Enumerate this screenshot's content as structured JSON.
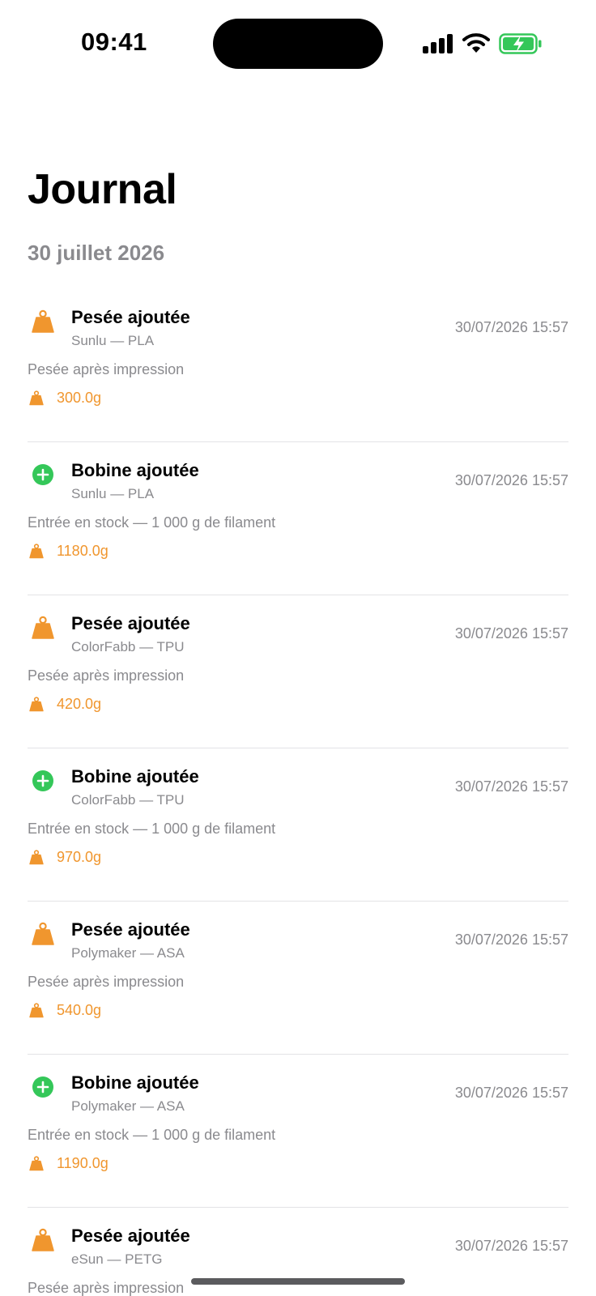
{
  "status_bar": {
    "time": "09:41",
    "signal_icon": "cellular-signal-icon",
    "wifi_icon": "wifi-icon",
    "battery_icon": "battery-charging-icon"
  },
  "header": {
    "title": "Journal"
  },
  "section": {
    "date": "30 juillet 2026"
  },
  "colors": {
    "accent_orange": "#f0962e",
    "add_green": "#34c759",
    "secondary_text": "#8a8a8e"
  },
  "entries": [
    {
      "type": "weigh",
      "icon": "weight-icon",
      "title": "Pesée ajoutée",
      "subtitle": "Sunlu — PLA",
      "timestamp": "30/07/2026 15:57",
      "note": "Pesée après impression",
      "weight": "300.0g"
    },
    {
      "type": "add",
      "icon": "plus-circle-icon",
      "title": "Bobine ajoutée",
      "subtitle": "Sunlu — PLA",
      "timestamp": "30/07/2026 15:57",
      "note": "Entrée en stock — 1 000 g de filament",
      "weight": "1180.0g"
    },
    {
      "type": "weigh",
      "icon": "weight-icon",
      "title": "Pesée ajoutée",
      "subtitle": "ColorFabb — TPU",
      "timestamp": "30/07/2026 15:57",
      "note": "Pesée après impression",
      "weight": "420.0g"
    },
    {
      "type": "add",
      "icon": "plus-circle-icon",
      "title": "Bobine ajoutée",
      "subtitle": "ColorFabb — TPU",
      "timestamp": "30/07/2026 15:57",
      "note": "Entrée en stock — 1 000 g de filament",
      "weight": "970.0g"
    },
    {
      "type": "weigh",
      "icon": "weight-icon",
      "title": "Pesée ajoutée",
      "subtitle": "Polymaker — ASA",
      "timestamp": "30/07/2026 15:57",
      "note": "Pesée après impression",
      "weight": "540.0g"
    },
    {
      "type": "add",
      "icon": "plus-circle-icon",
      "title": "Bobine ajoutée",
      "subtitle": "Polymaker — ASA",
      "timestamp": "30/07/2026 15:57",
      "note": "Entrée en stock — 1 000 g de filament",
      "weight": "1190.0g"
    },
    {
      "type": "weigh",
      "icon": "weight-icon",
      "title": "Pesée ajoutée",
      "subtitle": "eSun — PETG",
      "timestamp": "30/07/2026 15:57",
      "note": "Pesée après impression",
      "weight": ""
    }
  ]
}
